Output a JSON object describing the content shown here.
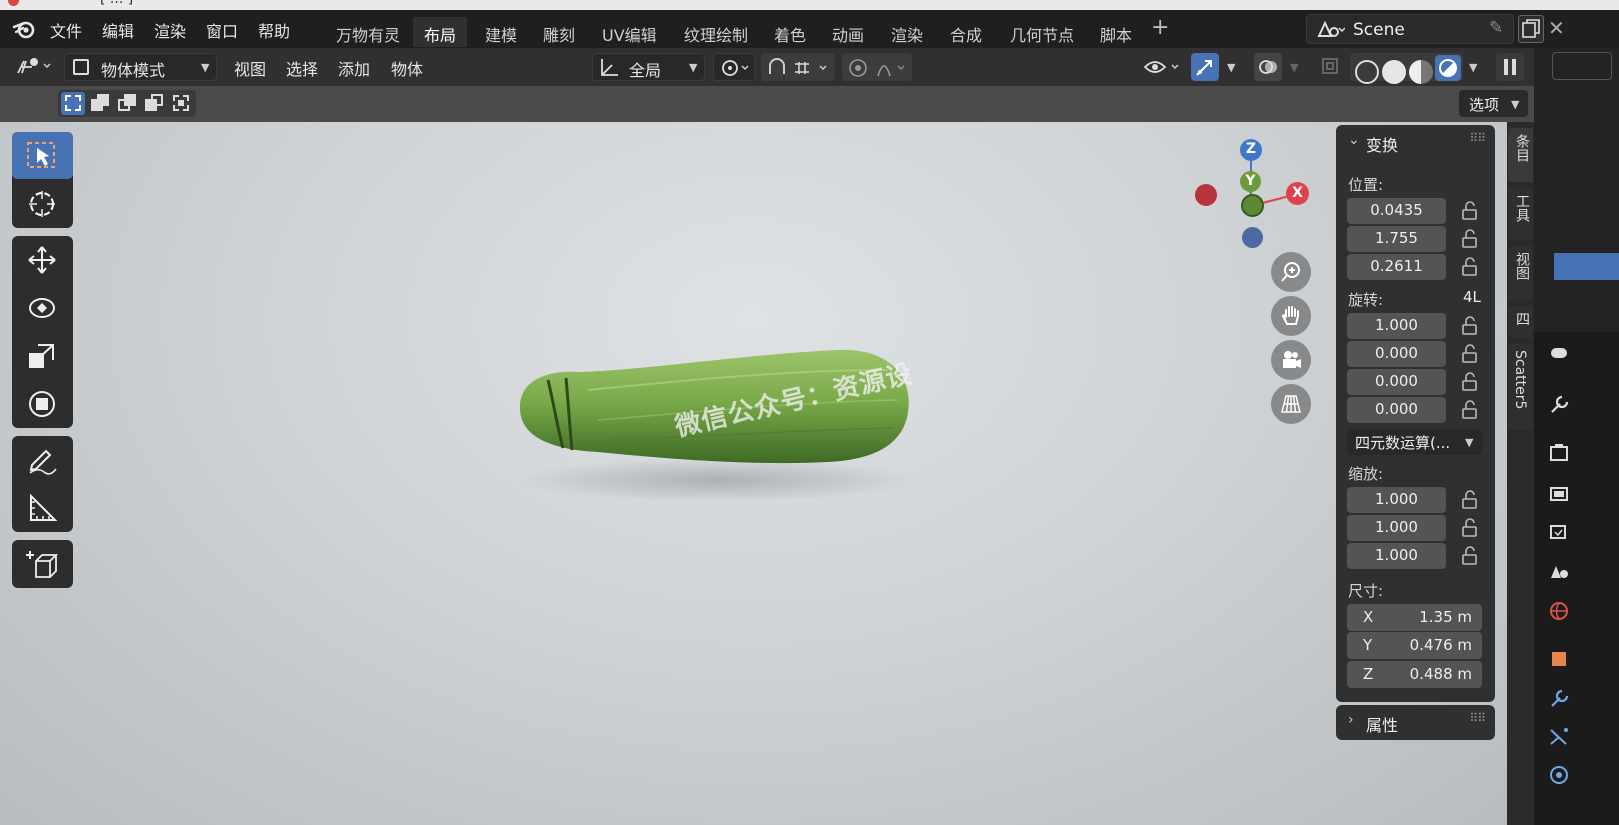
{
  "window": {
    "title": "[  ...  ]"
  },
  "menu": [
    "文件",
    "编辑",
    "渲染",
    "窗口",
    "帮助"
  ],
  "workspaces": [
    {
      "label": "万物有灵",
      "active": false
    },
    {
      "label": "布局",
      "active": true
    },
    {
      "label": "建模",
      "active": false
    },
    {
      "label": "雕刻",
      "active": false
    },
    {
      "label": "UV编辑",
      "active": false
    },
    {
      "label": "纹理绘制",
      "active": false
    },
    {
      "label": "着色",
      "active": false
    },
    {
      "label": "动画",
      "active": false
    },
    {
      "label": "渲染",
      "active": false
    },
    {
      "label": "合成",
      "active": false
    },
    {
      "label": "几何节点",
      "active": false
    },
    {
      "label": "脚本",
      "active": false
    }
  ],
  "scene": {
    "name": "Scene"
  },
  "header": {
    "mode": "物体模式",
    "menus": [
      "视图",
      "选择",
      "添加",
      "物体"
    ],
    "orientation": "全局"
  },
  "tool_settings": {
    "options_label": "选项"
  },
  "gizmo": {
    "z": "Z",
    "y": "Y",
    "x": "X"
  },
  "viewport": {
    "watermark": "微信公众号：资源设"
  },
  "npanel": {
    "transform_title": "变换",
    "location_label": "位置:",
    "location": [
      "0.0435",
      "1.755",
      "0.2611"
    ],
    "rotation_label": "旋转:",
    "rotation_mode_short": "4L",
    "rotation": [
      "1.000",
      "0.000",
      "0.000",
      "0.000"
    ],
    "rotation_mode": "四元数运算(...",
    "scale_label": "缩放:",
    "scale": [
      "1.000",
      "1.000",
      "1.000"
    ],
    "dimensions_label": "尺寸:",
    "dimensions": [
      {
        "axis": "X",
        "value": "1.35 m"
      },
      {
        "axis": "Y",
        "value": "0.476 m"
      },
      {
        "axis": "Z",
        "value": "0.488 m"
      }
    ],
    "properties_title": "属性"
  },
  "side_tabs": [
    "条目",
    "工具",
    "视图",
    "四",
    "Scatter5"
  ],
  "colors": {
    "accent": "#4772b3",
    "x_axis": "#e0424b",
    "y_axis": "#6b9c3b",
    "z_axis": "#3f78c9"
  }
}
